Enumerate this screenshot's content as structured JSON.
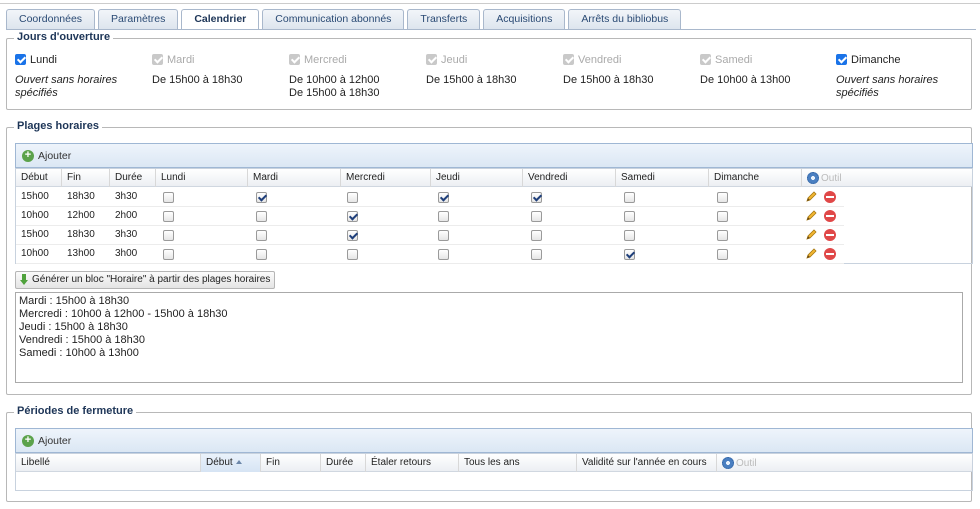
{
  "tabs": [
    "Coordonnées",
    "Paramètres",
    "Calendrier",
    "Communication abonnés",
    "Transferts",
    "Acquisitions",
    "Arrêts du bibliobus"
  ],
  "active_tab": 2,
  "opening_days": {
    "legend": "Jours d'ouverture",
    "days": [
      {
        "name": "Lundi",
        "checked": true,
        "enabled": true,
        "hours": [
          "Ouvert sans horaires",
          "spécifiés"
        ],
        "italic": true
      },
      {
        "name": "Mardi",
        "checked": true,
        "enabled": false,
        "hours": [
          "De 15h00 à 18h30"
        ],
        "italic": false
      },
      {
        "name": "Mercredi",
        "checked": true,
        "enabled": false,
        "hours": [
          "De 10h00 à 12h00",
          "De 15h00 à 18h30"
        ],
        "italic": false
      },
      {
        "name": "Jeudi",
        "checked": true,
        "enabled": false,
        "hours": [
          "De 15h00 à 18h30"
        ],
        "italic": false
      },
      {
        "name": "Vendredi",
        "checked": true,
        "enabled": false,
        "hours": [
          "De 15h00 à 18h30"
        ],
        "italic": false
      },
      {
        "name": "Samedi",
        "checked": true,
        "enabled": false,
        "hours": [
          "De 10h00 à 13h00"
        ],
        "italic": false
      },
      {
        "name": "Dimanche",
        "checked": true,
        "enabled": true,
        "hours": [
          "Ouvert sans horaires",
          "spécifiés"
        ],
        "italic": true
      }
    ]
  },
  "time_slots": {
    "legend": "Plages horaires",
    "add_label": "Ajouter",
    "columns": [
      "Début",
      "Fin",
      "Durée",
      "Lundi",
      "Mardi",
      "Mercredi",
      "Jeudi",
      "Vendredi",
      "Samedi",
      "Dimanche"
    ],
    "tools_label": "Outil",
    "rows": [
      {
        "start": "15h00",
        "end": "18h30",
        "duration": "3h30",
        "days": [
          false,
          true,
          false,
          true,
          true,
          false,
          false
        ]
      },
      {
        "start": "10h00",
        "end": "12h00",
        "duration": "2h00",
        "days": [
          false,
          false,
          true,
          false,
          false,
          false,
          false
        ]
      },
      {
        "start": "15h00",
        "end": "18h30",
        "duration": "3h30",
        "days": [
          false,
          false,
          true,
          false,
          false,
          false,
          false
        ]
      },
      {
        "start": "10h00",
        "end": "13h00",
        "duration": "3h00",
        "days": [
          false,
          false,
          false,
          false,
          false,
          true,
          false
        ]
      }
    ],
    "generate_label": "Générer un bloc \"Horaire\" à partir des plages horaires",
    "generated_text": "Mardi : 15h00 à 18h30\nMercredi : 10h00 à 12h00 - 15h00 à 18h30\nJeudi : 15h00 à 18h30\nVendredi : 15h00 à 18h30\nSamedi : 10h00 à 13h00"
  },
  "closures": {
    "legend": "Périodes de fermeture",
    "add_label": "Ajouter",
    "columns": [
      "Libellé",
      "Début",
      "Fin",
      "Durée",
      "Étaler retours",
      "Tous les ans",
      "Validité sur l'année en cours"
    ],
    "sorted_column": "Début",
    "tools_label": "Outil"
  },
  "icons": {
    "add": "plus-circle-icon",
    "edit": "pencil-icon",
    "delete": "minus-circle-icon",
    "tools": "gear-icon",
    "generate": "arrow-down-icon"
  }
}
